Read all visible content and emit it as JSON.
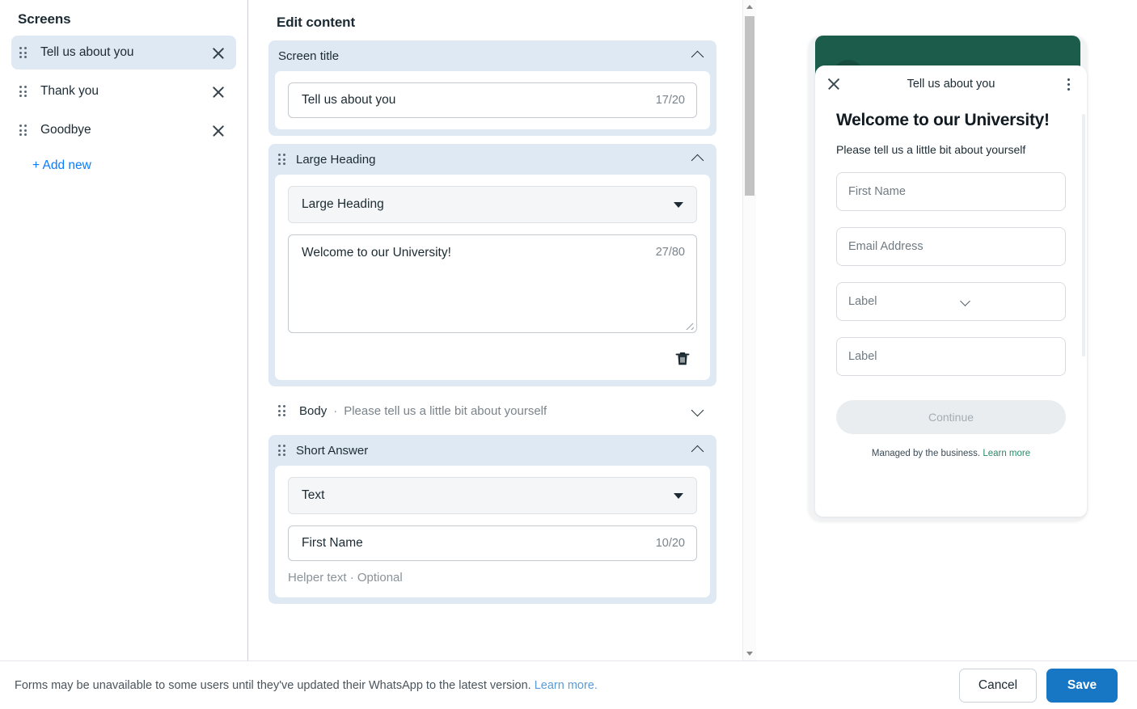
{
  "sidebar": {
    "title": "Screens",
    "items": [
      {
        "label": "Tell us about you",
        "active": true
      },
      {
        "label": "Thank you",
        "active": false
      },
      {
        "label": "Goodbye",
        "active": false
      }
    ],
    "add_new_label": "+ Add new"
  },
  "editor": {
    "title": "Edit content",
    "cards": [
      {
        "name": "screen-title",
        "head_label": "Screen title",
        "has_drag_handle": false,
        "expanded": true,
        "field_value": "Tell us about you",
        "field_counter": "17/20"
      },
      {
        "name": "large-heading",
        "head_label": "Large Heading",
        "has_drag_handle": true,
        "expanded": true,
        "select_value": "Large Heading",
        "textarea_value": "Welcome to our University!",
        "textarea_counter": "27/80",
        "delete_icon": "trash-icon"
      }
    ],
    "collapsed_row": {
      "name": "body",
      "head_label": "Body",
      "separator": "·",
      "sub_label": "Please tell us a little bit about yourself",
      "expanded": false
    },
    "short_answer": {
      "name": "short-answer",
      "head_label": "Short Answer",
      "expanded": true,
      "select_value": "Text",
      "field_value": "First Name",
      "field_counter": "10/20",
      "cut_off_label": "Helper text · Optional"
    }
  },
  "preview": {
    "header_color": "#1b5c4a",
    "sheet_title": "Tell us about you",
    "close_icon": "close-icon",
    "kebab_icon": "more-vertical-icon",
    "heading": "Welcome to our University!",
    "body": "Please tell us a little bit about yourself",
    "fields": [
      {
        "label": "First Name",
        "type": "text"
      },
      {
        "label": "Email Address",
        "type": "text"
      },
      {
        "label": "Label",
        "type": "dropdown"
      },
      {
        "label": "Label",
        "type": "text"
      }
    ],
    "continue_label": "Continue",
    "managed_text": "Managed by the business.",
    "managed_link": "Learn more"
  },
  "annotation": {
    "arrow_color": "#F5A623",
    "icon": "hand-drawn-arrow-icon"
  },
  "footer": {
    "note": "Forms may be unavailable to some users until they've updated their WhatsApp to the latest version.",
    "note_link": "Learn more.",
    "cancel_label": "Cancel",
    "save_label": "Save",
    "save_color": "#1877c4"
  }
}
